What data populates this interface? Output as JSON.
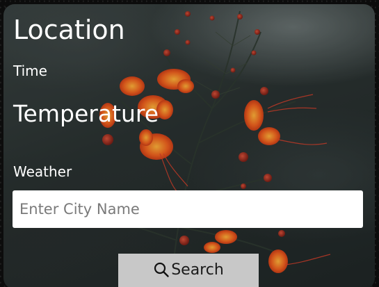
{
  "card": {
    "location": "Location",
    "time": "Time",
    "temperature": "Temperature",
    "weather": "Weather"
  },
  "search": {
    "placeholder": "Enter City Name",
    "value": "",
    "button_label": "Search",
    "button_icon": "search-icon"
  },
  "background": {
    "image": "red flowers on dark green stem"
  },
  "colors": {
    "text": "#ffffff",
    "input_bg": "#ffffff",
    "placeholder": "#7a7a7a",
    "button_bg": "#c8c8c8",
    "button_text": "#1a1a1a",
    "page_bg": "#0b0b0b"
  }
}
